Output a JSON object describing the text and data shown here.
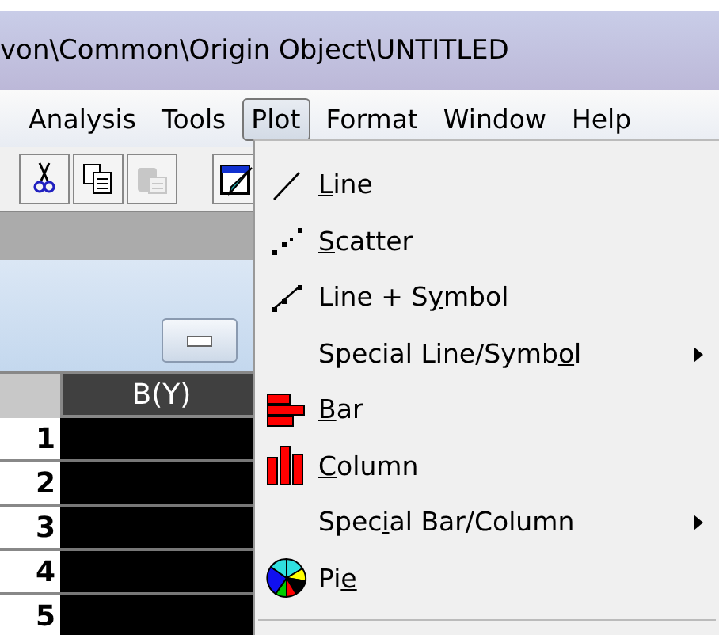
{
  "window": {
    "title": "von\\Common\\Origin Object\\UNTITLED"
  },
  "menubar": [
    {
      "label": "Analysis",
      "selected": false
    },
    {
      "label": "Tools",
      "selected": false
    },
    {
      "label": "Plot",
      "selected": true
    },
    {
      "label": "Format",
      "selected": false
    },
    {
      "label": "Window",
      "selected": false
    },
    {
      "label": "Help",
      "selected": false
    }
  ],
  "toolbar": [
    {
      "kind": "cut",
      "disabled": false
    },
    {
      "kind": "copy",
      "disabled": false
    },
    {
      "kind": "paste",
      "disabled": true
    },
    {
      "kind": "edit",
      "disabled": false
    }
  ],
  "worksheet": {
    "column_header": "B(Y)",
    "rows": [
      "1",
      "2",
      "3",
      "4",
      "5"
    ]
  },
  "menu": [
    {
      "kind": "line",
      "mnemonic": "L",
      "label_after": "ine",
      "submenu": false
    },
    {
      "kind": "scatter",
      "mnemonic": "S",
      "label_after": "catter",
      "submenu": false
    },
    {
      "kind": "linesymbol",
      "label_before": "Line + S",
      "mnemonic": "y",
      "label_after": "mbol",
      "submenu": false
    },
    {
      "kind": "none",
      "label_before": "Special Line/Symb",
      "mnemonic": "o",
      "label_after": "l",
      "submenu": true
    },
    {
      "kind": "bar",
      "mnemonic": "B",
      "label_after": "ar",
      "submenu": false
    },
    {
      "kind": "column",
      "mnemonic": "C",
      "label_after": "olumn",
      "submenu": false
    },
    {
      "kind": "none",
      "label_before": "Spec",
      "mnemonic": "i",
      "label_after": "al Bar/Column",
      "submenu": true
    },
    {
      "kind": "pie",
      "label_before": "Pi",
      "mnemonic": "e",
      "submenu": false
    }
  ]
}
